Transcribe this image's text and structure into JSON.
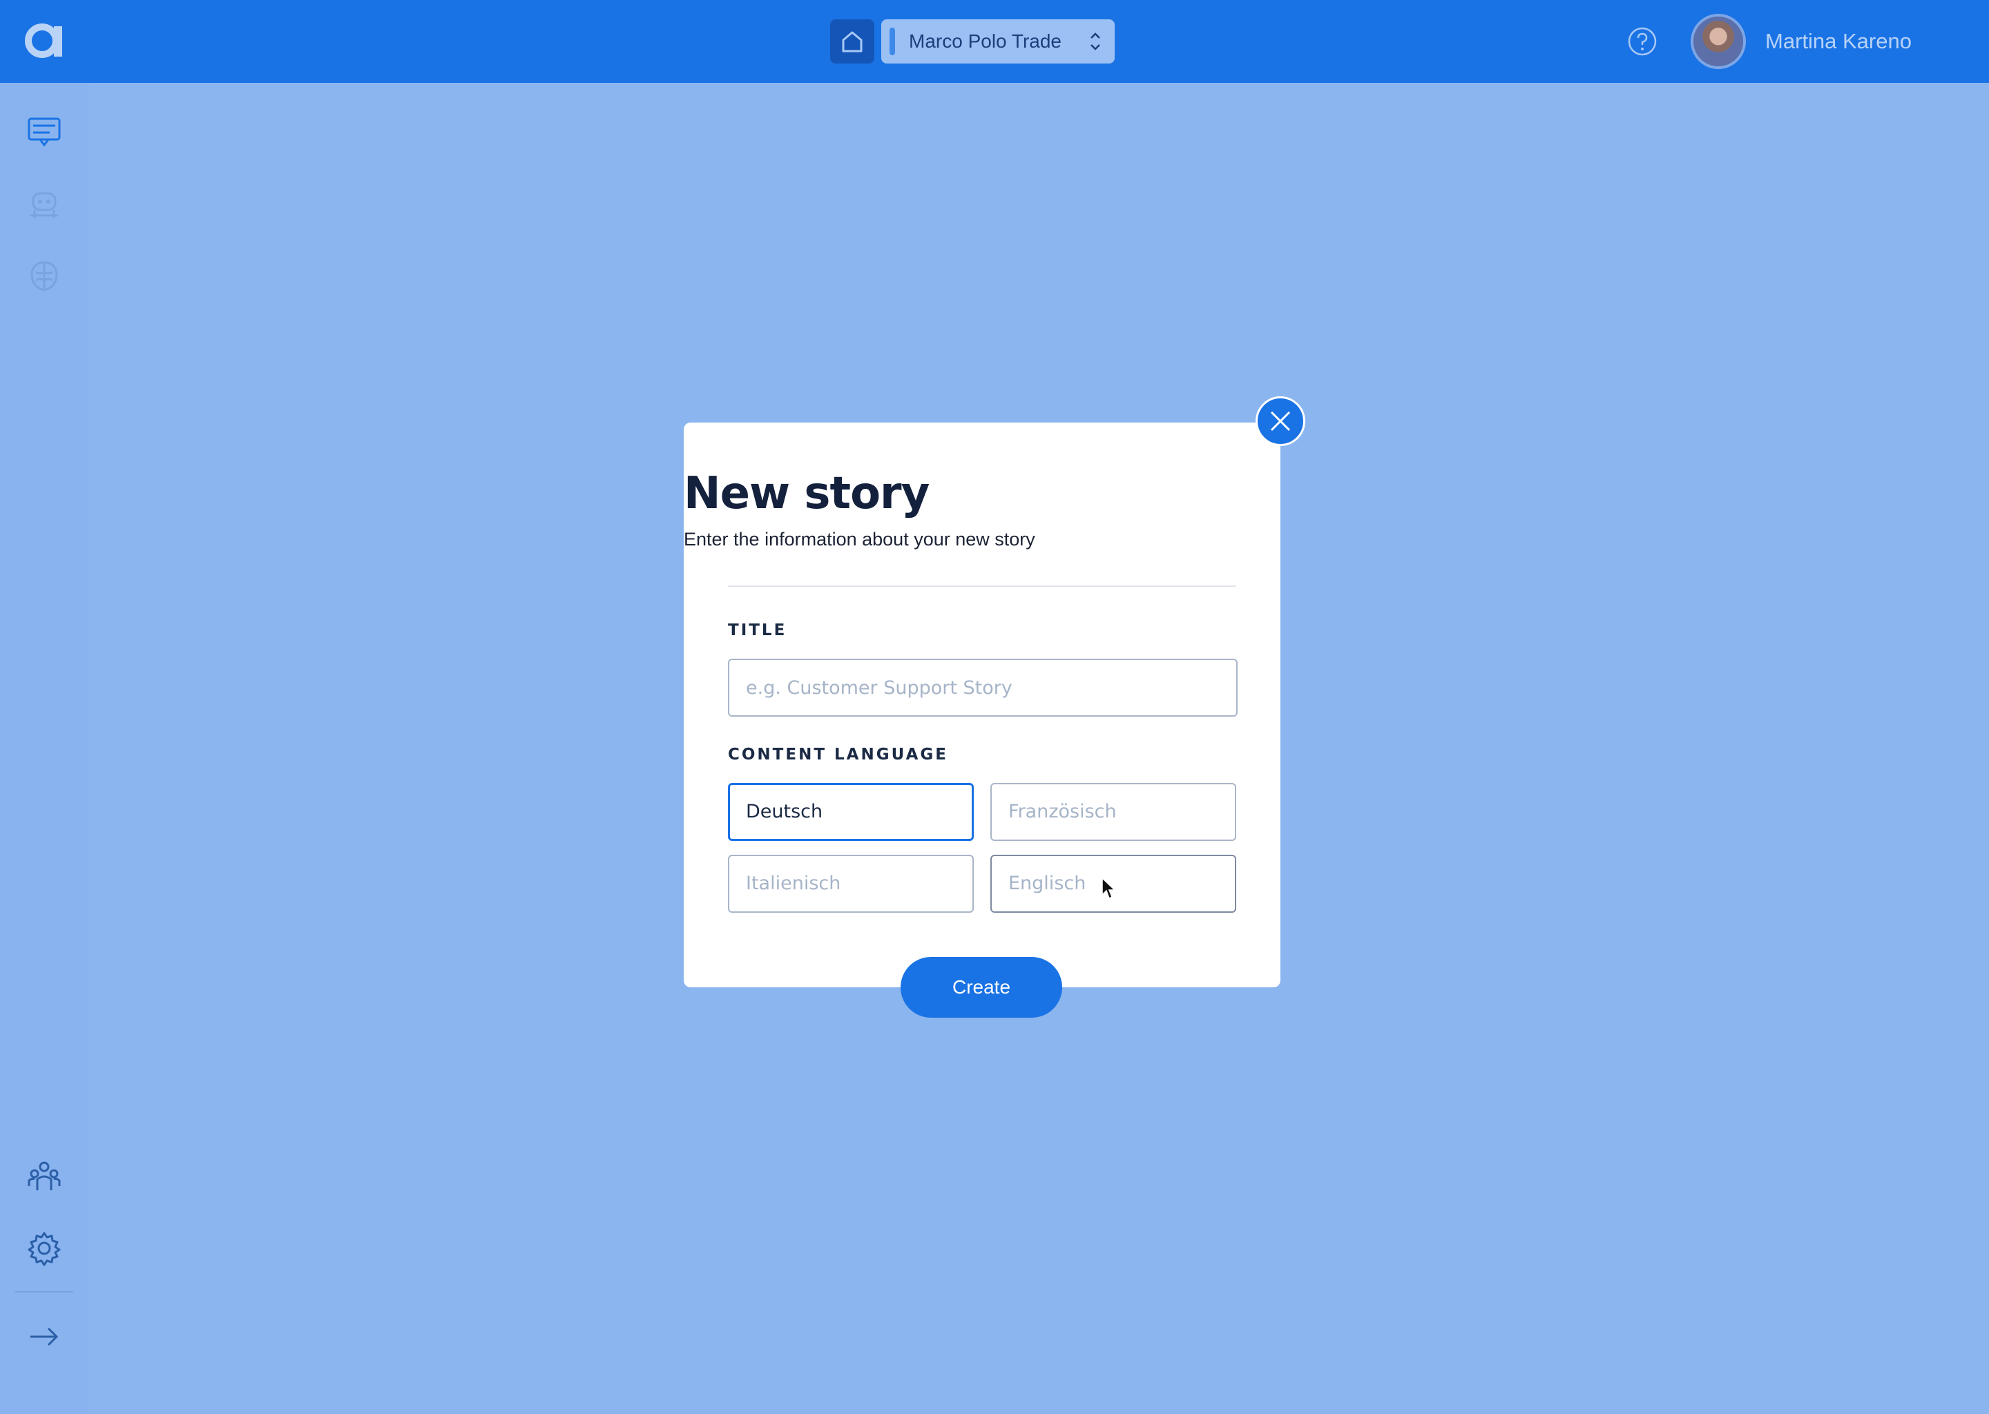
{
  "header": {
    "workspace_name": "Marco Polo Trade",
    "user_name": "Martina Kareno"
  },
  "modal": {
    "title": "New story",
    "subtitle": "Enter the information about your new story",
    "title_field": {
      "label": "TITLE",
      "value": "",
      "placeholder": "e.g. Customer Support Story"
    },
    "language_field": {
      "label": "CONTENT LANGUAGE",
      "options": [
        "Deutsch",
        "Französisch",
        "Italienisch",
        "Englisch"
      ],
      "selected": "Deutsch"
    },
    "create_label": "Create"
  },
  "icons": {
    "logo": "app-logo",
    "home": "home-icon",
    "workspace_chevron": "chevron-up-down-icon",
    "help": "help-icon",
    "sidebar_top": [
      "stories-icon",
      "bot-icon",
      "brain-icon"
    ],
    "sidebar_bottom": [
      "team-icon",
      "gear-icon",
      "expand-arrow-icon"
    ],
    "close": "close-icon"
  },
  "colors": {
    "topbar": "#1a73e5",
    "backdrop": "#8ab5ef",
    "accent": "#1a73e5",
    "heading": "#14213d"
  }
}
